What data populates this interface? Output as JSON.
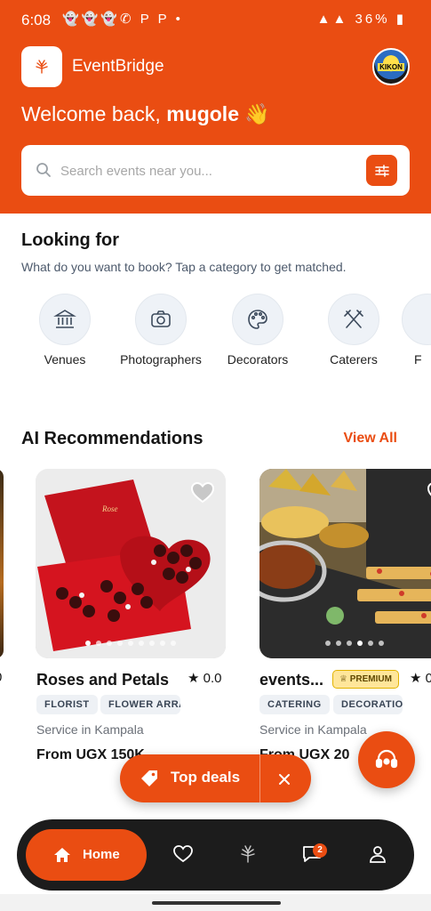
{
  "status_bar": {
    "time": "6:08",
    "left_icons": "👻👻👻✆ P P •",
    "battery": "36%"
  },
  "header": {
    "app_title": "EventBridge",
    "welcome_prefix": "Welcome back,",
    "user_name": "mugole",
    "wave_emoji": "👋",
    "avatar_text": "KIKON"
  },
  "search": {
    "placeholder": "Search events near you..."
  },
  "looking_for": {
    "title": "Looking for",
    "subtitle": "What do you want to book? Tap a category to get matched.",
    "categories": [
      {
        "label": "Venues",
        "icon": "bank-icon"
      },
      {
        "label": "Photographers",
        "icon": "camera-icon"
      },
      {
        "label": "Decorators",
        "icon": "palette-icon"
      },
      {
        "label": "Caterers",
        "icon": "cutlery-icon"
      },
      {
        "label": "F",
        "icon": "more-category-icon"
      }
    ]
  },
  "recommendations": {
    "title": "AI Recommendations",
    "view_all": "View All",
    "left_fragment_rating": "0",
    "cards": [
      {
        "title": "Roses and Petals",
        "rating": "0.0",
        "tags": [
          "FLORIST",
          "FLOWER ARRA"
        ],
        "service": "Service in Kampala",
        "price": "From UGX 150K"
      },
      {
        "title": "events...",
        "premium": "PREMIUM",
        "rating": "0",
        "tags": [
          "CATERING",
          "DECORATIO"
        ],
        "service": "Service in Kampala",
        "price": "From UGX 20"
      }
    ]
  },
  "floating": {
    "top_deals": "Top deals"
  },
  "bottom_nav": {
    "home": "Home",
    "messages_badge": "2"
  },
  "colors": {
    "brand": "#EA4D12",
    "nav_bg": "#1c1c1c",
    "premium_bg": "#ffe69a"
  }
}
